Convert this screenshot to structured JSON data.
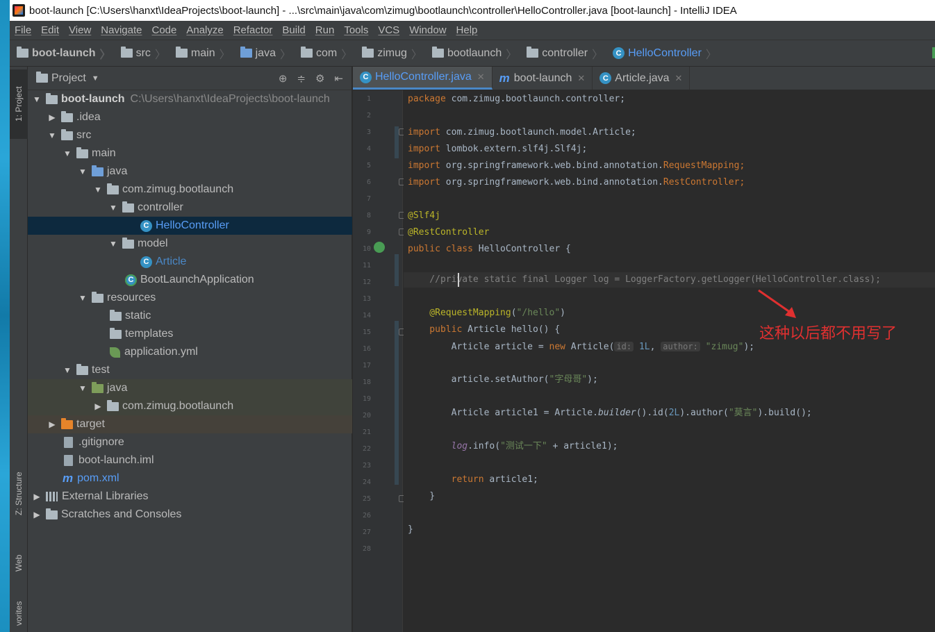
{
  "window": {
    "title": "boot-launch [C:\\Users\\hanxt\\IdeaProjects\\boot-launch] - ...\\src\\main\\java\\com\\zimug\\bootlaunch\\controller\\HelloController.java [boot-launch] - IntelliJ IDEA"
  },
  "menu": [
    "File",
    "Edit",
    "View",
    "Navigate",
    "Code",
    "Analyze",
    "Refactor",
    "Build",
    "Run",
    "Tools",
    "VCS",
    "Window",
    "Help"
  ],
  "breadcrumbs": [
    "boot-launch",
    "src",
    "main",
    "java",
    "com",
    "zimug",
    "bootlaunch",
    "controller",
    "HelloController"
  ],
  "toolstrip": {
    "project_tab": "1: Project",
    "structure_tab": "Z: Structure",
    "web_tab": "Web",
    "favorites_tab": "vorites"
  },
  "project_panel": {
    "title": "Project",
    "tree": [
      {
        "label": "boot-launch",
        "path": "C:\\Users\\hanxt\\IdeaProjects\\boot-launch"
      },
      {
        "label": ".idea"
      },
      {
        "label": "src"
      },
      {
        "label": "main"
      },
      {
        "label": "java"
      },
      {
        "label": "com.zimug.bootlaunch"
      },
      {
        "label": "controller"
      },
      {
        "label": "HelloController"
      },
      {
        "label": "model"
      },
      {
        "label": "Article"
      },
      {
        "label": "BootLaunchApplication"
      },
      {
        "label": "resources"
      },
      {
        "label": "static"
      },
      {
        "label": "templates"
      },
      {
        "label": "application.yml"
      },
      {
        "label": "test"
      },
      {
        "label": "java"
      },
      {
        "label": "com.zimug.bootlaunch"
      },
      {
        "label": "target"
      },
      {
        "label": ".gitignore"
      },
      {
        "label": "boot-launch.iml"
      },
      {
        "label": "pom.xml"
      },
      {
        "label": "External Libraries"
      },
      {
        "label": "Scratches and Consoles"
      }
    ]
  },
  "editor": {
    "tabs": [
      "HelloController.java",
      "boot-launch",
      "Article.java"
    ],
    "line_numbers": [
      "1",
      "2",
      "3",
      "4",
      "5",
      "6",
      "7",
      "8",
      "9",
      "10",
      "11",
      "12",
      "13",
      "14",
      "15",
      "16",
      "17",
      "18",
      "19",
      "20",
      "21",
      "22",
      "23",
      "24",
      "25",
      "26",
      "27",
      "28"
    ],
    "code": {
      "l1_kw": "package",
      "l1_rest": " com.zimug.bootlaunch.controller;",
      "import_kw": "import",
      "l3_rest": " com.zimug.bootlaunch.model.Article;",
      "l4_rest": " lombok.extern.slf4j.Slf4j;",
      "l5_pre": " org.springframework.web.bind.annotation.",
      "l5_cls": "RequestMapping",
      "l5_semi": ";",
      "l6_pre": " org.springframework.web.bind.annotation.",
      "l6_cls": "RestController",
      "l6_semi": ";",
      "l8": "@Slf4j",
      "l9": "@RestController",
      "l10_kw": "public class",
      "l10_rest": " HelloController {",
      "l12": "    //private static final Logger log = LoggerFactory.getLogger(HelloController.class);",
      "l14_ann": "    @RequestMapping",
      "l14_open": "(",
      "l14_str": "\"/hello\"",
      "l14_close": ")",
      "l15_kw": "    public",
      "l15_rest": " Article hello() {",
      "l16_pre": "        Article article = ",
      "l16_new": "new",
      "l16_mid": " Article(",
      "l16_hint1": "id:",
      "l16_num": " 1L",
      "l16_comma": ", ",
      "l16_hint2": "author:",
      "l16_str": " \"zimug\"",
      "l16_end": ");",
      "l18_pre": "        article.setAuthor(",
      "l18_str": "\"字母哥\"",
      "l18_end": ");",
      "l20_pre": "        Article article1 = Article.",
      "l20_it": "builder",
      "l20_mid": "().id(",
      "l20_num": "2L",
      "l20_mid2": ").author(",
      "l20_str": "\"莫言\"",
      "l20_end": ").build();",
      "l22_pre": "        ",
      "l22_field": "log",
      "l22_mid": ".info(",
      "l22_str": "\"测试一下\"",
      "l22_end": " + article1);",
      "l24_kw": "        return",
      "l24_rest": " article1;",
      "l25": "    }",
      "l27": "}"
    }
  },
  "annotation": {
    "text": "这种以后都不用写了",
    "color": "#e03030"
  }
}
